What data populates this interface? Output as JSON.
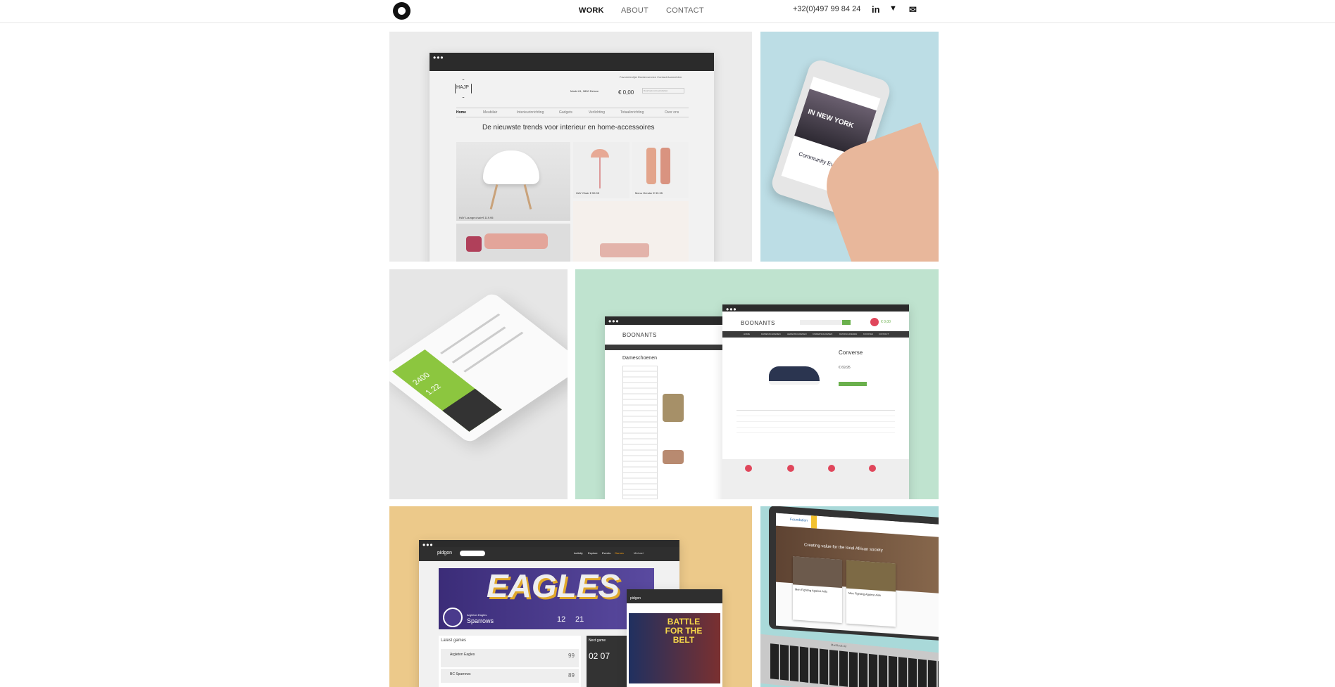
{
  "header": {
    "logo_icon": "circle-logo-icon",
    "nav": [
      {
        "label": "WORK",
        "active": true
      },
      {
        "label": "ABOUT",
        "active": false
      },
      {
        "label": "CONTACT",
        "active": false
      }
    ],
    "phone": "+32(0)497 99 84 24",
    "social": [
      {
        "icon": "linkedin-icon",
        "glyph": "in"
      },
      {
        "icon": "twitter-icon",
        "glyph": "🐦"
      },
      {
        "icon": "mail-icon",
        "glyph": "✉"
      }
    ]
  },
  "projects": [
    {
      "name": "hajp",
      "bg": "#ebebeb",
      "brand": "HAJP",
      "links": "Favorietenlijst   Klantenservice   Contact   Aanmelden",
      "address": "Markt 61, 9800 Deinze",
      "cart": "€ 0,00",
      "search": "Doorzoek onze producten",
      "menu": [
        "Home",
        "Meubilair",
        "Interieurinrichting",
        "Gadgets",
        "Verlichting",
        "Totaalinrichting",
        "Over ons"
      ],
      "headline": "De nieuwste trends voor interieur en home-accessoires",
      "products": [
        "HAY Lounge chair   € 119.95",
        "HAY Chair   € 59.95",
        "Menu Grinder   € 39.95"
      ]
    },
    {
      "name": "community-events",
      "bg": "#bcdde5",
      "line1": "IN NEW YORK",
      "line2": "Community Events"
    },
    {
      "name": "tablet-app",
      "bg": "#e6e6e6",
      "value1": "2400",
      "value2": "1.22"
    },
    {
      "name": "boonants",
      "bg": "#bfe3cf",
      "brand": "BOONANTS",
      "category": "Dameschoenen",
      "product": "Converse",
      "price": "€ 69,95",
      "cart": "€ 0,00",
      "menu": [
        "HOME",
        "DAMESSCHOENEN",
        "HERENSCHOENEN",
        "KINDERSCHOENEN",
        "DANSSCHOENEN",
        "KOOPJES",
        "CONTACT"
      ]
    },
    {
      "name": "pidgon",
      "bg": "#ecc98a",
      "brand": "pidgon",
      "nav": [
        "Activity",
        "Explore",
        "Events",
        "Games",
        "Michael"
      ],
      "team": "EAGLES",
      "subteam": "Sparrows",
      "club": "Argleton Eagles",
      "latest": "Latest games",
      "next": "Next game",
      "games": [
        {
          "team": "Argleton Eagles",
          "score": "99"
        },
        {
          "team": "BC Sparrows",
          "score": "89"
        }
      ],
      "countdown": "02  07",
      "stat1": "12",
      "stat2": "21",
      "mobile_headline": "BATTLE FOR THE BELT"
    },
    {
      "name": "foundation",
      "bg": "#a9d9d9",
      "brand": "Foundation",
      "hero": "Creating value for the local African society",
      "card": "Men Fighting Against Aids",
      "laptop": "MacBook Air"
    }
  ]
}
